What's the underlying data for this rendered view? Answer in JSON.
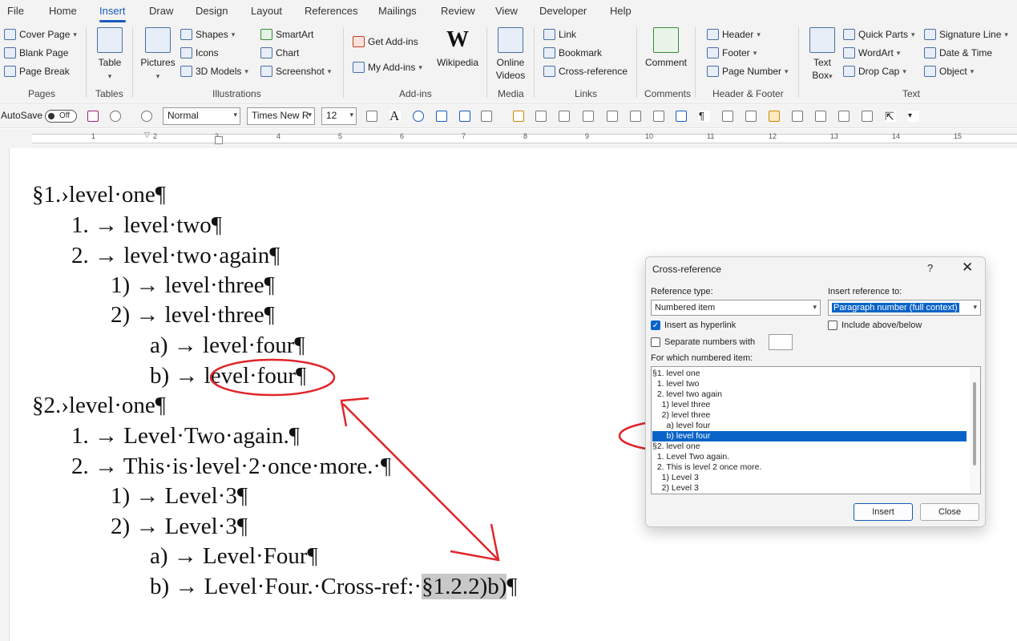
{
  "menu_tabs": [
    "File",
    "Home",
    "Insert",
    "Draw",
    "Design",
    "Layout",
    "References",
    "Mailings",
    "Review",
    "View",
    "Developer",
    "Help"
  ],
  "active_tab": "Insert",
  "ribbon": {
    "pages": {
      "cover_page": "Cover Page",
      "blank_page": "Blank Page",
      "page_break": "Page Break",
      "label": "Pages"
    },
    "tables": {
      "table": "Table",
      "label": "Tables"
    },
    "illustrations": {
      "pictures": "Pictures",
      "shapes": "Shapes",
      "icons": "Icons",
      "models": "3D Models",
      "smartart": "SmartArt",
      "chart": "Chart",
      "screenshot": "Screenshot",
      "label": "Illustrations"
    },
    "addins": {
      "get_addins": "Get Add-ins",
      "my_addins": "My Add-ins",
      "wikipedia": "Wikipedia",
      "label": "Add-ins"
    },
    "media": {
      "online_videos_1": "Online",
      "online_videos_2": "Videos",
      "label": "Media"
    },
    "links": {
      "link": "Link",
      "bookmark": "Bookmark",
      "cross_reference": "Cross-reference",
      "label": "Links"
    },
    "comments": {
      "comment": "Comment",
      "label": "Comments"
    },
    "header_footer": {
      "header": "Header",
      "footer": "Footer",
      "page_number": "Page Number",
      "label": "Header & Footer"
    },
    "text": {
      "text_box_1": "Text",
      "text_box_2": "Box",
      "quick_parts": "Quick Parts",
      "wordart": "WordArt",
      "drop_cap": "Drop Cap",
      "signature_line": "Signature Line",
      "date_time": "Date & Time",
      "object": "Object",
      "label": "Text"
    }
  },
  "qat": {
    "autosave": "AutoSave",
    "autosave_state": "Off",
    "style": "Normal",
    "font": "Times New R",
    "size": "12"
  },
  "ruler_numbers": [
    "1",
    "2",
    "3",
    "4",
    "5",
    "6",
    "7",
    "8",
    "9",
    "10",
    "11",
    "12",
    "13",
    "14",
    "15"
  ],
  "document": {
    "lines": [
      "§1.›level·one¶",
      "1. → level·two¶",
      "2. → level·two·again¶",
      "1) → level·three¶",
      "2) → level·three¶",
      "a)  →  level·four¶",
      "b)  →  level·four¶",
      "§2.›level·one¶",
      "1. → Level·Two·again.¶",
      "2. → This·is·level·2·once·more.·¶",
      "1) → Level·3¶",
      "2) → Level·3¶",
      "a)  →  Level·Four¶"
    ],
    "last_line_prefix": "b)  →  Level·Four.·Cross-ref:·",
    "last_line_field": "§1.2.2)b)",
    "last_line_suffix": "¶"
  },
  "dialog": {
    "title": "Cross-reference",
    "help": "?",
    "close_glyph": "✕",
    "reference_type_label": "Reference type:",
    "reference_type_value": "Numbered item",
    "insert_reference_label": "Insert reference to:",
    "insert_reference_value": "Paragraph number (full context)",
    "insert_hyperlink_label": "Insert as hyperlink",
    "insert_hyperlink_checked": true,
    "include_above_below_label": "Include above/below",
    "separate_numbers_label": "Separate numbers with",
    "which_item_label": "For which numbered item:",
    "items": [
      "§1. level one",
      "  1. level two",
      "  2. level two again",
      "    1) level three",
      "    2) level three",
      "      a) level four",
      "      b) level four",
      "§2. level one",
      "  1. Level Two again.",
      "  2. This is level 2 once more.",
      "    1) Level 3",
      "    2) Level 3"
    ],
    "selected_index": 6,
    "insert_button": "Insert",
    "close_button": "Close"
  },
  "annotation_color": "#e0262b",
  "accent_color": "#185abd"
}
